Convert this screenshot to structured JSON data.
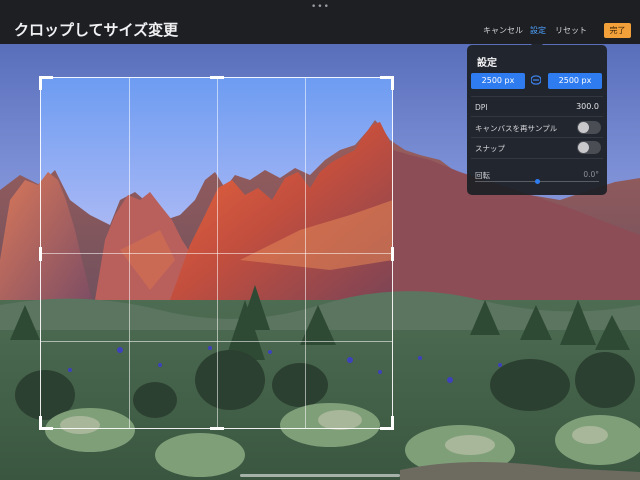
{
  "topbar": {
    "menu_dots": "•••",
    "title": "クロップしてサイズ変更",
    "cancel": "キャンセル",
    "settings": "設定",
    "reset": "リセット",
    "done": "完了"
  },
  "settings_popover": {
    "title": "設定",
    "width": "2500 px",
    "height": "2500 px",
    "dpi_label": "DPI",
    "dpi_value": "300.0",
    "resample_label": "キャンバスを再サンプル",
    "resample_on": false,
    "snap_label": "スナップ",
    "snap_on": false,
    "rotation_label": "回転",
    "rotation_value": "0.0°"
  },
  "colors": {
    "accent": "#2f7cf0",
    "done": "#f2a13a",
    "topbar": "#1d1f23"
  }
}
